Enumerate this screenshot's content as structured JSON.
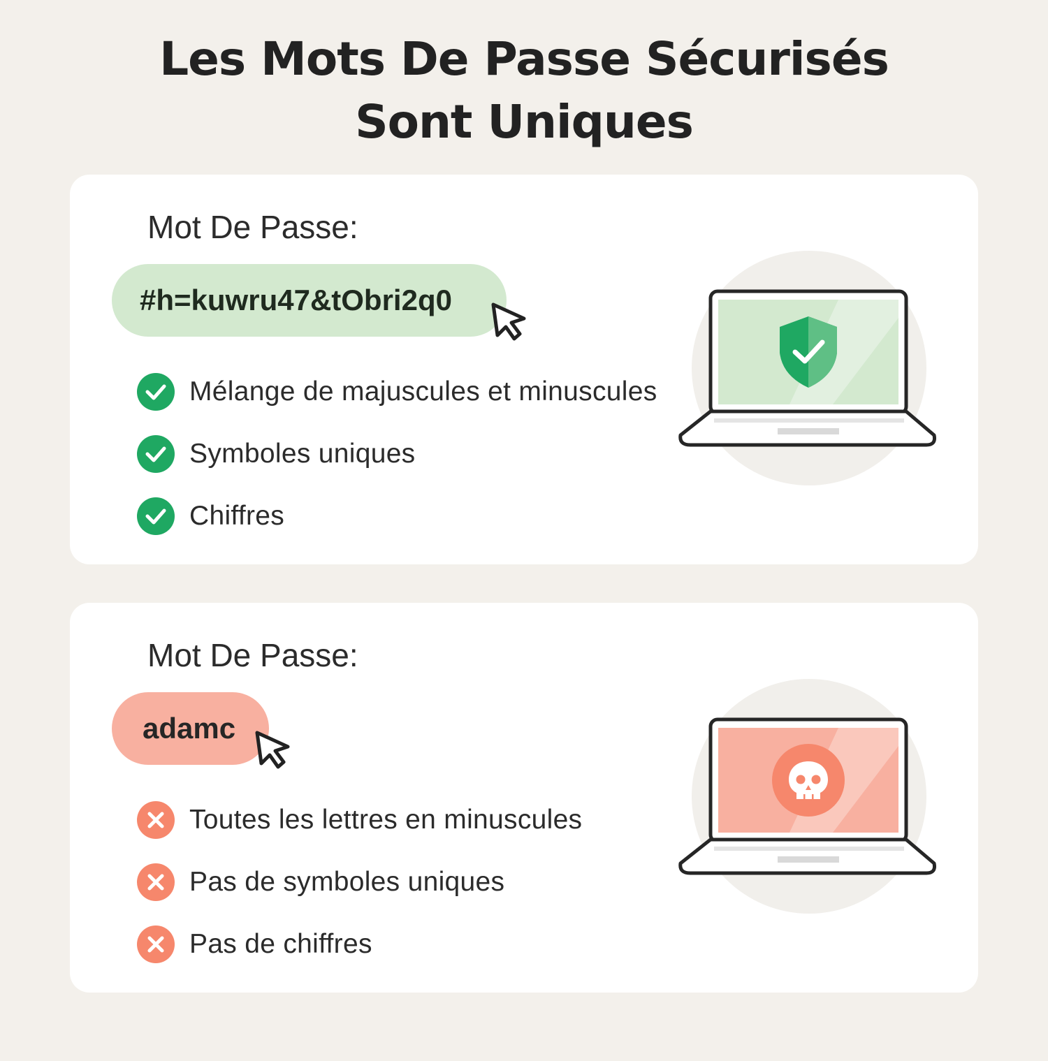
{
  "title": {
    "line1": "Les Mots De Passe Sécurisés",
    "line2": "Sont Uniques"
  },
  "colors": {
    "background": "#f3f0eb",
    "card": "#ffffff",
    "strong_pill": "#d3e9cf",
    "strong_check": "#1fa862",
    "weak_pill": "#f8b0a0",
    "weak_cross": "#f6876c",
    "outline": "#2b2b2b"
  },
  "strong_card": {
    "label": "Mot De Passe:",
    "password": "#h=kuwru47&tObri2q0",
    "status_icon": "check-circle-icon",
    "screen_icon": "shield-check-icon",
    "criteria": [
      "Mélange de majuscules et minuscules",
      "Symboles uniques",
      "Chiffres"
    ]
  },
  "weak_card": {
    "label": "Mot De Passe:",
    "password": "adamc",
    "status_icon": "x-circle-icon",
    "screen_icon": "skull-icon",
    "criteria": [
      "Toutes les lettres en minuscules",
      "Pas de symboles uniques",
      "Pas de chiffres"
    ]
  }
}
